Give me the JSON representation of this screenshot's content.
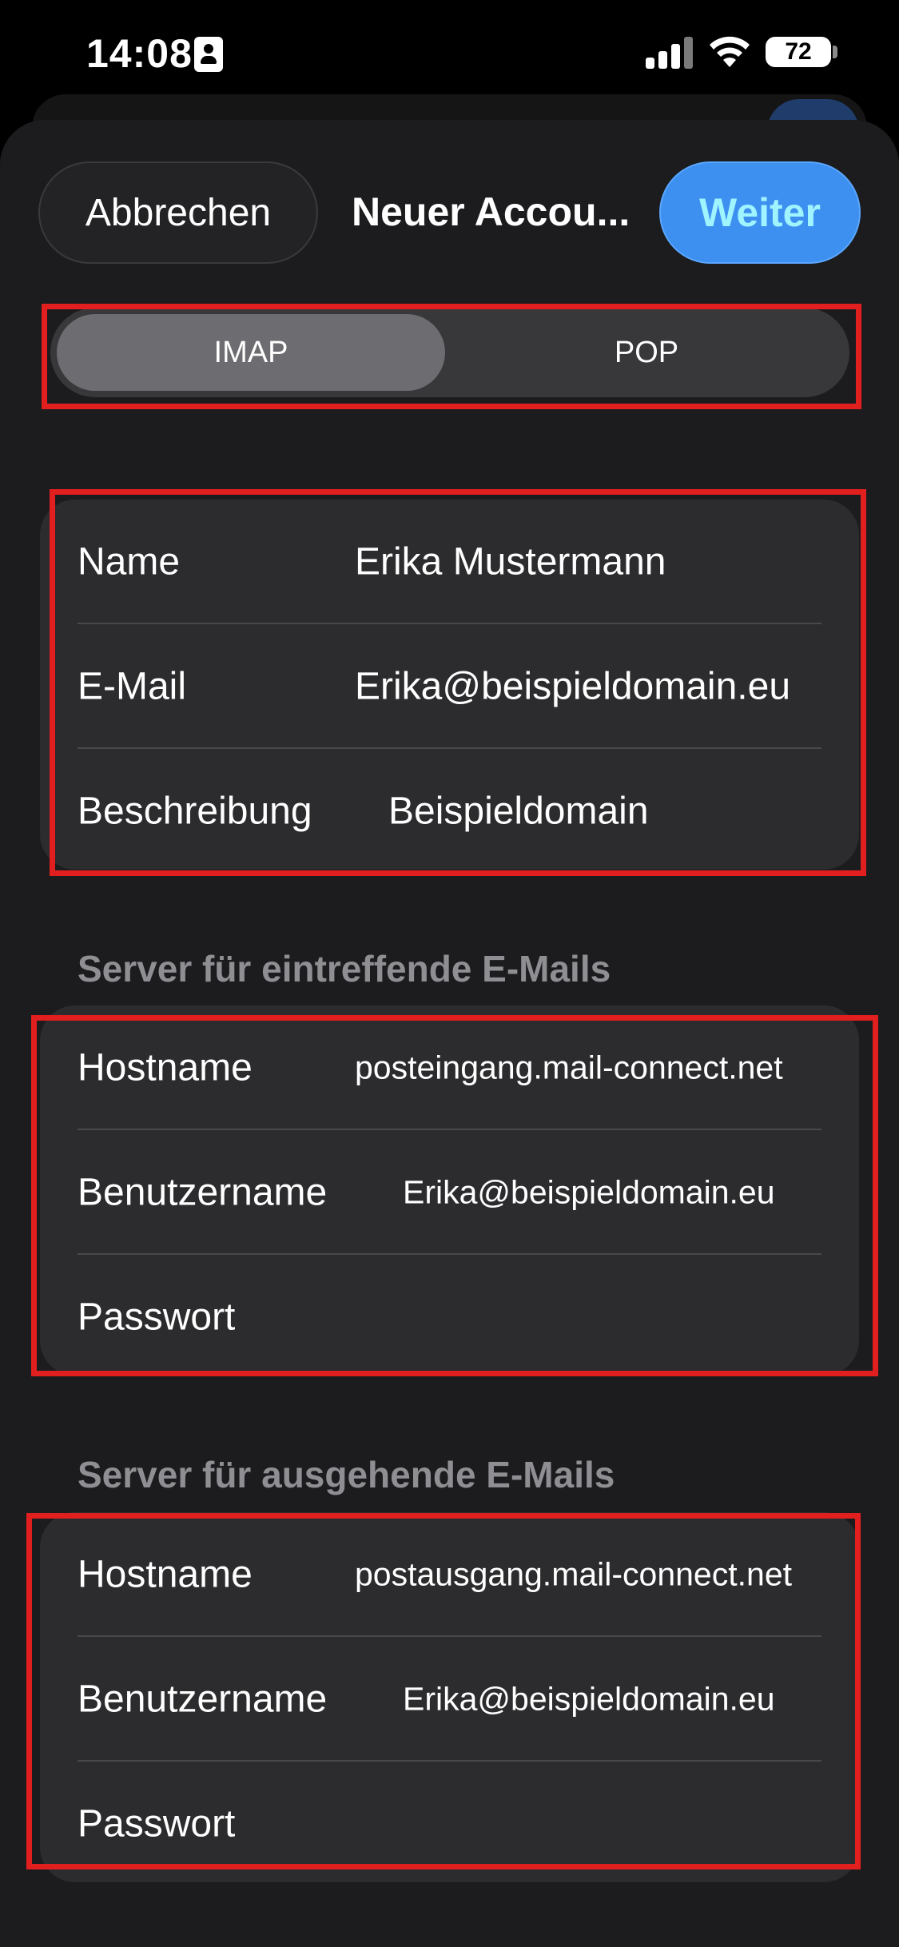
{
  "status_bar": {
    "time": "14:08",
    "battery": "72"
  },
  "nav": {
    "cancel_label": "Abbrechen",
    "title": "Neuer Accou...",
    "next_label": "Weiter"
  },
  "segmented": {
    "options": [
      "IMAP",
      "POP"
    ],
    "selected": "IMAP"
  },
  "account": {
    "rows": [
      {
        "label": "Name",
        "value": "Erika Mustermann"
      },
      {
        "label": "E-Mail",
        "value": "Erika@beispieldomain.eu"
      },
      {
        "label": "Beschreibung",
        "value": "Beispieldomain"
      }
    ]
  },
  "incoming": {
    "header": "Server für eintreffende E-Mails",
    "rows": [
      {
        "label": "Hostname",
        "value": "posteingang.mail-connect.net"
      },
      {
        "label": "Benutzername",
        "value": "Erika@beispieldomain.eu"
      },
      {
        "label": "Passwort",
        "value": ""
      }
    ]
  },
  "outgoing": {
    "header": "Server für ausgehende E-Mails",
    "rows": [
      {
        "label": "Hostname",
        "value": "postausgang.mail-connect.net"
      },
      {
        "label": "Benutzername",
        "value": "Erika@beispieldomain.eu"
      },
      {
        "label": "Passwort",
        "value": ""
      }
    ]
  },
  "colors": {
    "accent": "#3d8ff0",
    "highlight": "#e21f1f",
    "background": "#1c1c1e",
    "group": "#2c2c2e"
  }
}
